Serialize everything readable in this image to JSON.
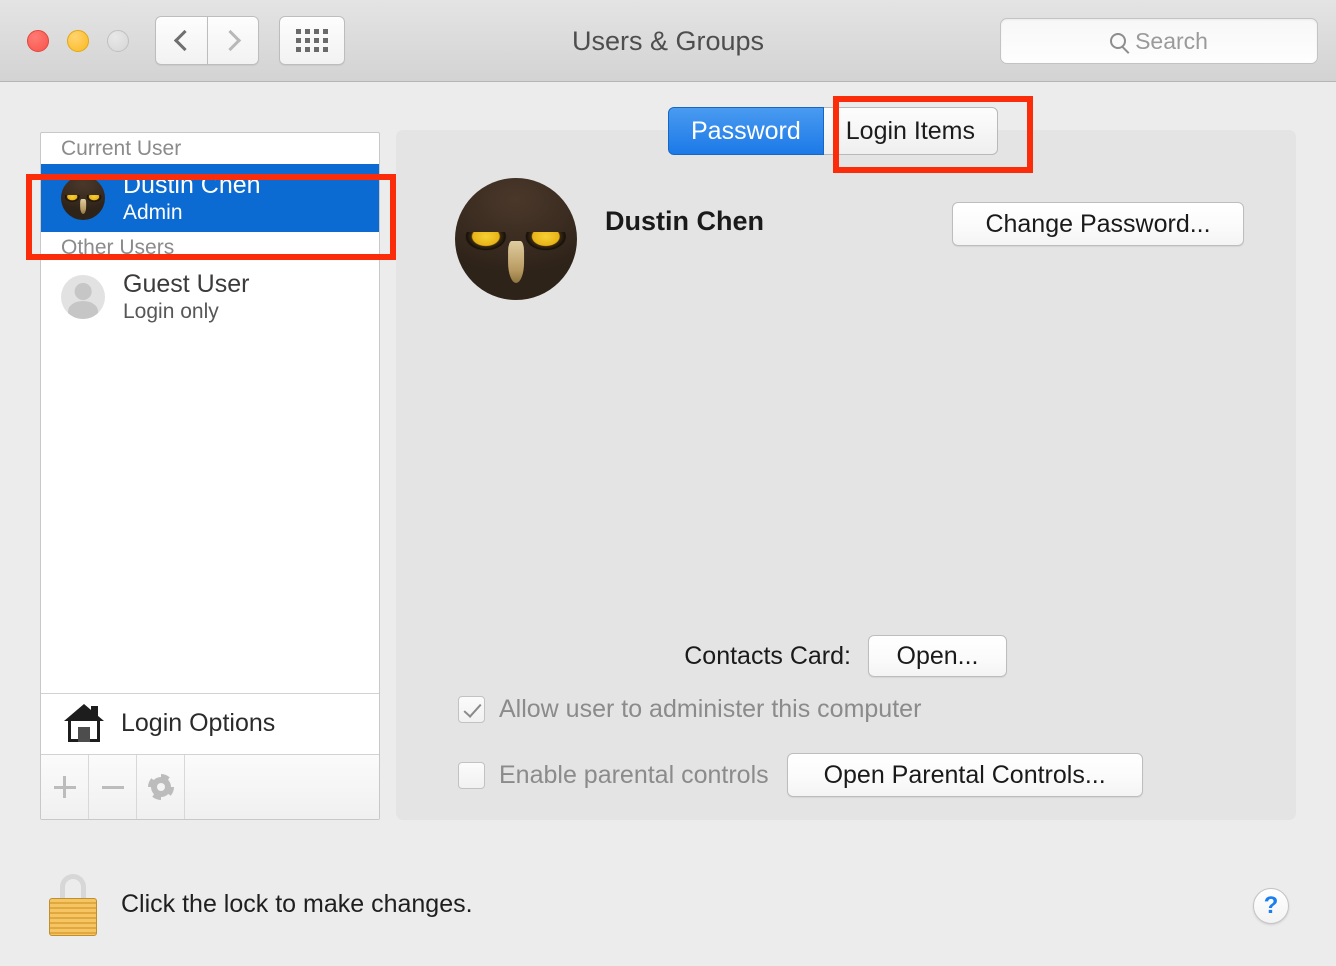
{
  "titlebar": {
    "title": "Users & Groups",
    "traffic_lights": [
      "close",
      "minimize",
      "zoom"
    ],
    "back_icon": "chevron-left-icon",
    "forward_icon": "chevron-right-icon",
    "grid_icon": "grid-dots-icon",
    "search": {
      "icon": "search-icon",
      "placeholder": "Search",
      "value": ""
    }
  },
  "sidebar": {
    "groups": [
      {
        "header": "Current User",
        "users": [
          {
            "name": "Dustin Chen",
            "role": "Admin",
            "avatar": "owl-photo-avatar",
            "selected": true
          }
        ]
      },
      {
        "header": "Other Users",
        "users": [
          {
            "name": "Guest User",
            "role": "Login only",
            "avatar": "generic-person-avatar",
            "selected": false
          }
        ]
      }
    ],
    "login_options": {
      "label": "Login Options",
      "icon": "house-icon"
    },
    "toolbar": {
      "add_label": "+",
      "remove_label": "−",
      "settings_icon": "gear-icon",
      "enabled": false
    }
  },
  "content": {
    "tabs": [
      {
        "label": "Password",
        "active": true
      },
      {
        "label": "Login Items",
        "active": false
      }
    ],
    "account": {
      "name": "Dustin Chen",
      "avatar": "owl-photo-avatar"
    },
    "change_password_label": "Change Password...",
    "contacts_card": {
      "label": "Contacts Card:",
      "button_label": "Open..."
    },
    "checkboxes": [
      {
        "label": "Allow user to administer this computer",
        "checked": true,
        "enabled": false
      },
      {
        "label": "Enable parental controls",
        "checked": false,
        "enabled": false
      }
    ],
    "parental_button_label": "Open Parental Controls..."
  },
  "footer": {
    "lock_icon": "closed-padlock-icon",
    "lock_text": "Click the lock to make changes.",
    "help_label": "?"
  },
  "annotations": {
    "accent_color": "#fb2c09",
    "boxes": [
      {
        "name": "selected-user-row-highlight"
      },
      {
        "name": "login-items-tab-highlight"
      }
    ]
  },
  "colors": {
    "selection_blue": "#0b6bd3",
    "tab_active_blue": "#1c79e8",
    "window_bg": "#ececec",
    "content_bg": "#e4e4e4",
    "annotation_red": "#fb2c09",
    "help_blue": "#1a7ef0"
  }
}
